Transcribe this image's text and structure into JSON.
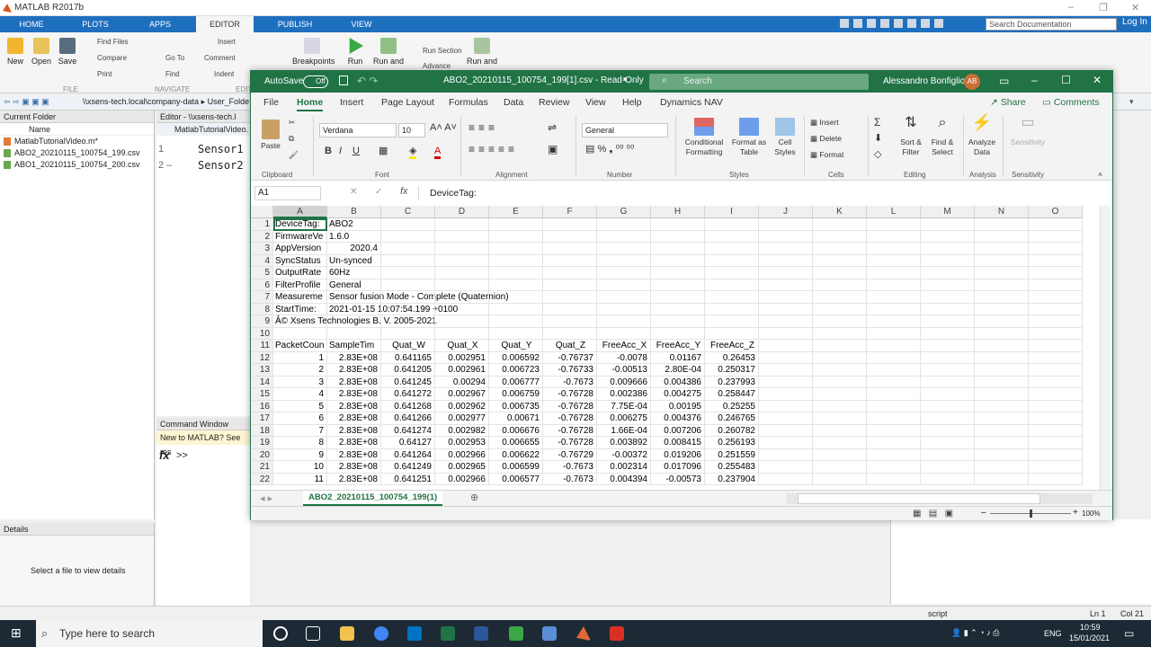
{
  "matlab": {
    "title": "MATLAB R2017b",
    "tabs": [
      "HOME",
      "PLOTS",
      "APPS",
      "EDITOR",
      "PUBLISH",
      "VIEW"
    ],
    "search_placeholder": "Search Documentation",
    "login": "Log In",
    "ribbon": {
      "new": "New",
      "open": "Open",
      "save": "Save",
      "find_files": "Find Files",
      "compare": "Compare",
      "print": "Print",
      "insert": "Insert",
      "comment": "Comment",
      "indent": "Indent",
      "goto": "Go To",
      "find": "Find",
      "breakpoints": "Breakpoints",
      "run": "Run",
      "run_advance": "Run and",
      "run_section": "Run Section",
      "advance": "Advance",
      "run_time": "Run and",
      "file_label": "FILE",
      "navigate_label": "NAVIGATE",
      "edit_label": "EDIT"
    },
    "address": "\\\\xsens-tech.local\\company-data  ▸  User_Folde",
    "current_folder": "Current Folder",
    "name_col": "Name",
    "files": [
      "MatlabTutorialVideo.m*",
      "ABO2_20210115_100754_199.csv",
      "ABO1_20210115_100754_200.csv"
    ],
    "details": "Details",
    "details_hint": "Select a file to view details",
    "editor_title": "Editor - \\\\xsens-tech.l",
    "editor_tab": "MatlabTutorialVideo.",
    "editor_lines": [
      {
        "n": "1",
        "t": "Sensor1"
      },
      {
        "n": "2 –",
        "t": "Sensor2"
      }
    ],
    "command_window": "Command Window",
    "cmd_banner": "New to MATLAB? See res",
    "prompt": ">>",
    "status_mode": "script",
    "status_ln": "Ln 1",
    "status_col": "Col 21"
  },
  "excel": {
    "autosave": "AutoSave",
    "autosave_state": "Off",
    "filename": "ABO2_20210115_100754_199[1].csv  -  Read-Only",
    "search": "Search",
    "user": "Alessandro Bonfiglio",
    "user_initials": "AB",
    "tabs": [
      "File",
      "Home",
      "Insert",
      "Page Layout",
      "Formulas",
      "Data",
      "Review",
      "View",
      "Help",
      "Dynamics NAV"
    ],
    "share": "Share",
    "comments": "Comments",
    "ribbon": {
      "paste": "Paste",
      "font": "Verdana",
      "size": "10",
      "number_format": "General",
      "cond_fmt": "Conditional Formatting",
      "fmt_table": "Format as Table",
      "cell_styles": "Cell Styles",
      "insert": "Insert",
      "delete": "Delete",
      "format": "Format",
      "sort": "Sort & Filter",
      "find": "Find & Select",
      "analyze": "Analyze Data",
      "sensitivity": "Sensitivity"
    },
    "groups": [
      "Clipboard",
      "Font",
      "Alignment",
      "Number",
      "Styles",
      "Cells",
      "Editing",
      "Analysis",
      "Sensitivity"
    ],
    "namebox": "A1",
    "formula": "DeviceTag:",
    "columns": [
      "A",
      "B",
      "C",
      "D",
      "E",
      "F",
      "G",
      "H",
      "I",
      "J",
      "K",
      "L",
      "M",
      "N",
      "O"
    ],
    "rows": [
      [
        "DeviceTag:",
        "ABO2"
      ],
      [
        "FirmwareVe",
        "1.6.0"
      ],
      [
        "AppVersion",
        "2020.4"
      ],
      [
        "SyncStatus",
        "Un-synced"
      ],
      [
        "OutputRate",
        "60Hz"
      ],
      [
        "FilterProfile",
        "General"
      ],
      [
        "Measureme",
        "Sensor fusion Mode - Complete (Quaternion)"
      ],
      [
        "StartTime:",
        "2021-01-15 10:07:54.199 +0100"
      ],
      [
        "Â© Xsens Technologies B. V. 2005-2021"
      ],
      [],
      [
        "PacketCoun",
        "SampleTim",
        "Quat_W",
        "Quat_X",
        "Quat_Y",
        "Quat_Z",
        "FreeAcc_X",
        "FreeAcc_Y",
        "FreeAcc_Z"
      ],
      [
        "1",
        "2.83E+08",
        "0.641165",
        "0.002951",
        "0.006592",
        "-0.76737",
        "-0.0078",
        "0.01167",
        "0.26453"
      ],
      [
        "2",
        "2.83E+08",
        "0.641205",
        "0.002961",
        "0.006723",
        "-0.76733",
        "-0.00513",
        "2.80E-04",
        "0.250317"
      ],
      [
        "3",
        "2.83E+08",
        "0.641245",
        "0.00294",
        "0.006777",
        "-0.7673",
        "0.009666",
        "0.004386",
        "0.237993"
      ],
      [
        "4",
        "2.83E+08",
        "0.641272",
        "0.002967",
        "0.006759",
        "-0.76728",
        "0.002386",
        "0.004275",
        "0.258447"
      ],
      [
        "5",
        "2.83E+08",
        "0.641268",
        "0.002962",
        "0.006735",
        "-0.76728",
        "7.75E-04",
        "0.00195",
        "0.25255"
      ],
      [
        "6",
        "2.83E+08",
        "0.641266",
        "0.002977",
        "0.00671",
        "-0.76728",
        "0.006275",
        "0.004376",
        "0.246765"
      ],
      [
        "7",
        "2.83E+08",
        "0.641274",
        "0.002982",
        "0.006676",
        "-0.76728",
        "1.66E-04",
        "0.007206",
        "0.260782"
      ],
      [
        "8",
        "2.83E+08",
        "0.64127",
        "0.002953",
        "0.006655",
        "-0.76728",
        "0.003892",
        "0.008415",
        "0.256193"
      ],
      [
        "9",
        "2.83E+08",
        "0.641264",
        "0.002966",
        "0.006622",
        "-0.76729",
        "-0.00372",
        "0.019206",
        "0.251559"
      ],
      [
        "10",
        "2.83E+08",
        "0.641249",
        "0.002965",
        "0.006599",
        "-0.7673",
        "0.002314",
        "0.017096",
        "0.255483"
      ],
      [
        "11",
        "2.83E+08",
        "0.641251",
        "0.002966",
        "0.006577",
        "-0.7673",
        "0.004394",
        "-0.00573",
        "0.237904"
      ]
    ],
    "sheet_tab": "ABO2_20210115_100754_199(1)",
    "zoom": "100%"
  },
  "taskbar": {
    "search": "Type here to search",
    "lang": "ENG",
    "time": "10:59",
    "date": "15/01/2021"
  }
}
